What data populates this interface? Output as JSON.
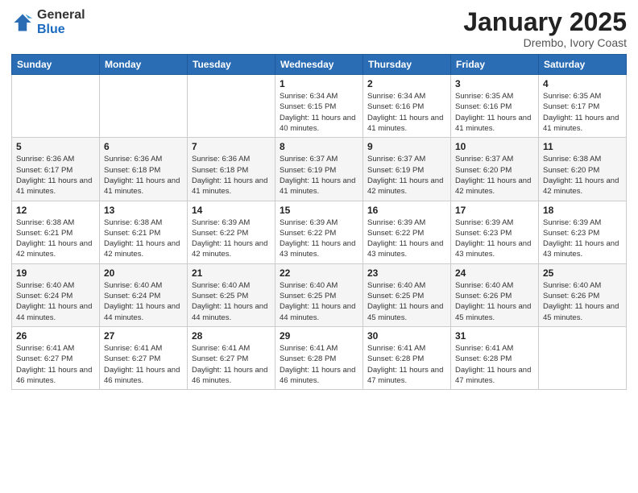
{
  "header": {
    "logo_general": "General",
    "logo_blue": "Blue",
    "month_title": "January 2025",
    "location": "Drembo, Ivory Coast"
  },
  "days_of_week": [
    "Sunday",
    "Monday",
    "Tuesday",
    "Wednesday",
    "Thursday",
    "Friday",
    "Saturday"
  ],
  "weeks": [
    [
      {
        "day": "",
        "sunrise": "",
        "sunset": "",
        "daylight": ""
      },
      {
        "day": "",
        "sunrise": "",
        "sunset": "",
        "daylight": ""
      },
      {
        "day": "",
        "sunrise": "",
        "sunset": "",
        "daylight": ""
      },
      {
        "day": "1",
        "sunrise": "Sunrise: 6:34 AM",
        "sunset": "Sunset: 6:15 PM",
        "daylight": "Daylight: 11 hours and 40 minutes."
      },
      {
        "day": "2",
        "sunrise": "Sunrise: 6:34 AM",
        "sunset": "Sunset: 6:16 PM",
        "daylight": "Daylight: 11 hours and 41 minutes."
      },
      {
        "day": "3",
        "sunrise": "Sunrise: 6:35 AM",
        "sunset": "Sunset: 6:16 PM",
        "daylight": "Daylight: 11 hours and 41 minutes."
      },
      {
        "day": "4",
        "sunrise": "Sunrise: 6:35 AM",
        "sunset": "Sunset: 6:17 PM",
        "daylight": "Daylight: 11 hours and 41 minutes."
      }
    ],
    [
      {
        "day": "5",
        "sunrise": "Sunrise: 6:36 AM",
        "sunset": "Sunset: 6:17 PM",
        "daylight": "Daylight: 11 hours and 41 minutes."
      },
      {
        "day": "6",
        "sunrise": "Sunrise: 6:36 AM",
        "sunset": "Sunset: 6:18 PM",
        "daylight": "Daylight: 11 hours and 41 minutes."
      },
      {
        "day": "7",
        "sunrise": "Sunrise: 6:36 AM",
        "sunset": "Sunset: 6:18 PM",
        "daylight": "Daylight: 11 hours and 41 minutes."
      },
      {
        "day": "8",
        "sunrise": "Sunrise: 6:37 AM",
        "sunset": "Sunset: 6:19 PM",
        "daylight": "Daylight: 11 hours and 41 minutes."
      },
      {
        "day": "9",
        "sunrise": "Sunrise: 6:37 AM",
        "sunset": "Sunset: 6:19 PM",
        "daylight": "Daylight: 11 hours and 42 minutes."
      },
      {
        "day": "10",
        "sunrise": "Sunrise: 6:37 AM",
        "sunset": "Sunset: 6:20 PM",
        "daylight": "Daylight: 11 hours and 42 minutes."
      },
      {
        "day": "11",
        "sunrise": "Sunrise: 6:38 AM",
        "sunset": "Sunset: 6:20 PM",
        "daylight": "Daylight: 11 hours and 42 minutes."
      }
    ],
    [
      {
        "day": "12",
        "sunrise": "Sunrise: 6:38 AM",
        "sunset": "Sunset: 6:21 PM",
        "daylight": "Daylight: 11 hours and 42 minutes."
      },
      {
        "day": "13",
        "sunrise": "Sunrise: 6:38 AM",
        "sunset": "Sunset: 6:21 PM",
        "daylight": "Daylight: 11 hours and 42 minutes."
      },
      {
        "day": "14",
        "sunrise": "Sunrise: 6:39 AM",
        "sunset": "Sunset: 6:22 PM",
        "daylight": "Daylight: 11 hours and 42 minutes."
      },
      {
        "day": "15",
        "sunrise": "Sunrise: 6:39 AM",
        "sunset": "Sunset: 6:22 PM",
        "daylight": "Daylight: 11 hours and 43 minutes."
      },
      {
        "day": "16",
        "sunrise": "Sunrise: 6:39 AM",
        "sunset": "Sunset: 6:22 PM",
        "daylight": "Daylight: 11 hours and 43 minutes."
      },
      {
        "day": "17",
        "sunrise": "Sunrise: 6:39 AM",
        "sunset": "Sunset: 6:23 PM",
        "daylight": "Daylight: 11 hours and 43 minutes."
      },
      {
        "day": "18",
        "sunrise": "Sunrise: 6:39 AM",
        "sunset": "Sunset: 6:23 PM",
        "daylight": "Daylight: 11 hours and 43 minutes."
      }
    ],
    [
      {
        "day": "19",
        "sunrise": "Sunrise: 6:40 AM",
        "sunset": "Sunset: 6:24 PM",
        "daylight": "Daylight: 11 hours and 44 minutes."
      },
      {
        "day": "20",
        "sunrise": "Sunrise: 6:40 AM",
        "sunset": "Sunset: 6:24 PM",
        "daylight": "Daylight: 11 hours and 44 minutes."
      },
      {
        "day": "21",
        "sunrise": "Sunrise: 6:40 AM",
        "sunset": "Sunset: 6:25 PM",
        "daylight": "Daylight: 11 hours and 44 minutes."
      },
      {
        "day": "22",
        "sunrise": "Sunrise: 6:40 AM",
        "sunset": "Sunset: 6:25 PM",
        "daylight": "Daylight: 11 hours and 44 minutes."
      },
      {
        "day": "23",
        "sunrise": "Sunrise: 6:40 AM",
        "sunset": "Sunset: 6:25 PM",
        "daylight": "Daylight: 11 hours and 45 minutes."
      },
      {
        "day": "24",
        "sunrise": "Sunrise: 6:40 AM",
        "sunset": "Sunset: 6:26 PM",
        "daylight": "Daylight: 11 hours and 45 minutes."
      },
      {
        "day": "25",
        "sunrise": "Sunrise: 6:40 AM",
        "sunset": "Sunset: 6:26 PM",
        "daylight": "Daylight: 11 hours and 45 minutes."
      }
    ],
    [
      {
        "day": "26",
        "sunrise": "Sunrise: 6:41 AM",
        "sunset": "Sunset: 6:27 PM",
        "daylight": "Daylight: 11 hours and 46 minutes."
      },
      {
        "day": "27",
        "sunrise": "Sunrise: 6:41 AM",
        "sunset": "Sunset: 6:27 PM",
        "daylight": "Daylight: 11 hours and 46 minutes."
      },
      {
        "day": "28",
        "sunrise": "Sunrise: 6:41 AM",
        "sunset": "Sunset: 6:27 PM",
        "daylight": "Daylight: 11 hours and 46 minutes."
      },
      {
        "day": "29",
        "sunrise": "Sunrise: 6:41 AM",
        "sunset": "Sunset: 6:28 PM",
        "daylight": "Daylight: 11 hours and 46 minutes."
      },
      {
        "day": "30",
        "sunrise": "Sunrise: 6:41 AM",
        "sunset": "Sunset: 6:28 PM",
        "daylight": "Daylight: 11 hours and 47 minutes."
      },
      {
        "day": "31",
        "sunrise": "Sunrise: 6:41 AM",
        "sunset": "Sunset: 6:28 PM",
        "daylight": "Daylight: 11 hours and 47 minutes."
      },
      {
        "day": "",
        "sunrise": "",
        "sunset": "",
        "daylight": ""
      }
    ]
  ]
}
